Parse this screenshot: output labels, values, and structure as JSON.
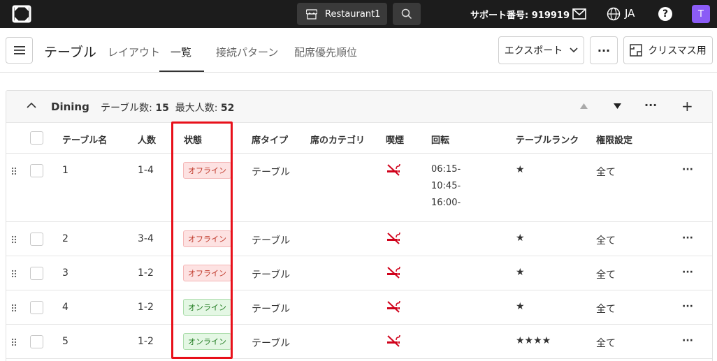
{
  "topbar": {
    "restaurant": "Restaurant1",
    "support": "サポート番号: 919919",
    "lang": "JA",
    "help": "?",
    "avatar": "T"
  },
  "header": {
    "title": "テーブル",
    "tabs": [
      "レイアウト",
      "一覧",
      "接続パターン",
      "配席優先順位"
    ],
    "active_tab": "一覧",
    "export_label": "エクスポート",
    "more_label": "···",
    "xmas_label": "クリスマス用"
  },
  "group": {
    "name": "Dining",
    "table_count_label": "テーブル数:",
    "table_count": "15",
    "max_people_label": "最大人数:",
    "max_people": "52",
    "more_label": "···",
    "add_label": "+"
  },
  "columns": [
    "テーブル名",
    "人数",
    "状態",
    "席タイプ",
    "席のカテゴリ",
    "喫煙",
    "回転",
    "テーブルランク",
    "権限設定"
  ],
  "rows": [
    {
      "name": "1",
      "people": "1-4",
      "status": "オフライン",
      "status_type": "off",
      "seat": "テーブル",
      "rotation": [
        "06:15-",
        "10:45-",
        "16:00-"
      ],
      "rank": "★",
      "permission": "全て",
      "more": "···"
    },
    {
      "name": "2",
      "people": "3-4",
      "status": "オフライン",
      "status_type": "off",
      "seat": "テーブル",
      "rotation": [],
      "rank": "★",
      "permission": "全て",
      "more": "···"
    },
    {
      "name": "3",
      "people": "1-2",
      "status": "オフライン",
      "status_type": "off",
      "seat": "テーブル",
      "rotation": [],
      "rank": "★",
      "permission": "全て",
      "more": "···"
    },
    {
      "name": "4",
      "people": "1-2",
      "status": "オンライン",
      "status_type": "on",
      "seat": "テーブル",
      "rotation": [],
      "rank": "★",
      "permission": "全て",
      "more": "···"
    },
    {
      "name": "5",
      "people": "1-2",
      "status": "オンライン",
      "status_type": "on",
      "seat": "テーブル",
      "rotation": [],
      "rank": "★★★★",
      "permission": "全て",
      "more": "···"
    }
  ],
  "colors": {
    "topbar": "#1c1c1c",
    "avatar": "#8b5cf6",
    "highlight": "#e8101a",
    "nosmoke": "#d0021b"
  },
  "icons": {
    "logo": "brand-logo-icon",
    "store": "store-icon",
    "search": "search-icon",
    "mail": "mail-icon",
    "globe": "globe-icon",
    "help": "help-icon",
    "menu": "hamburger-menu-icon",
    "chevron": "chevron-down-icon",
    "floorplan": "floorplan-icon",
    "collapse": "chevron-up-icon",
    "sort_up": "triangle-up-icon",
    "sort_down": "triangle-down-icon",
    "drag": "drag-handle-icon",
    "no_smoking": "no-smoking-icon"
  }
}
